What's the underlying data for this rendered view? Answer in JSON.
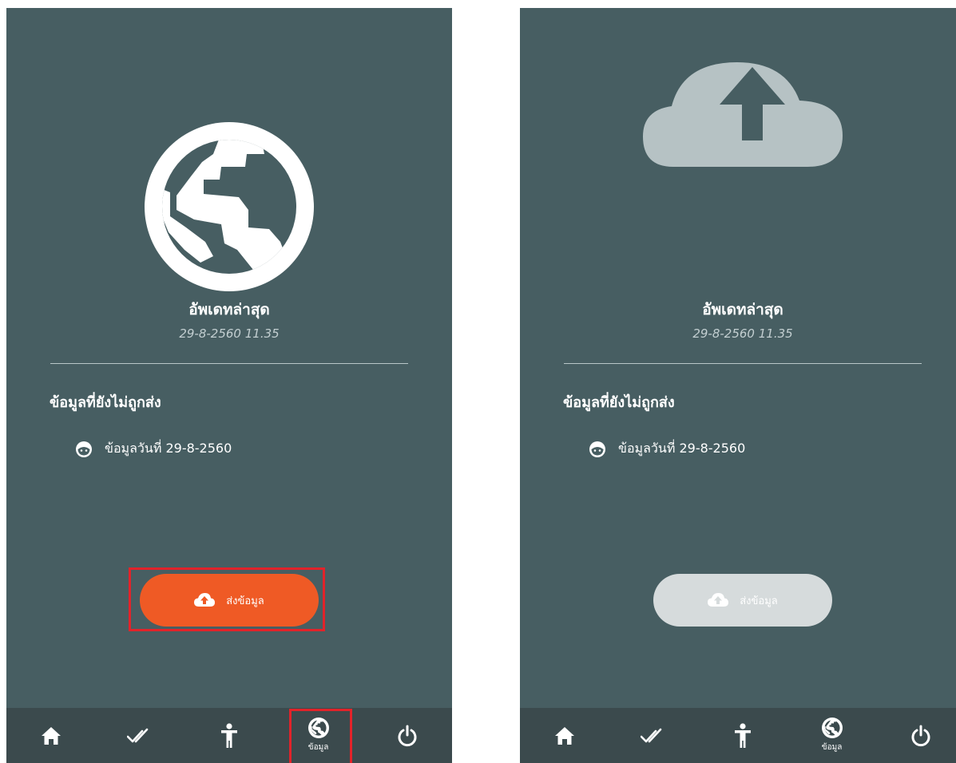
{
  "screens": [
    {
      "update_title": "อัพเดทล่าสุด",
      "update_time": "29-8-2560  11.35",
      "section_title": "ข้อมูลที่ยังไม่ถูกส่ง",
      "data_item": "ข้อมูลวันที่ 29-8-2560",
      "send_button_label": "ส่งข้อมูล",
      "nav_active_label": "ข้อมูล"
    },
    {
      "update_title": "อัพเดทล่าสุด",
      "update_time": "29-8-2560  11.35",
      "section_title": "ข้อมูลที่ยังไม่ถูกส่ง",
      "data_item": "ข้อมูลวันที่ 29-8-2560",
      "send_button_label": "ส่งข้อมูล",
      "nav_active_label": "ข้อมูล"
    }
  ],
  "colors": {
    "screen_bg": "#475e62",
    "nav_bg": "#3b4a4d",
    "accent_orange": "#ef5a25",
    "disabled_button": "#d6dbdc",
    "highlight_red": "#e2232a"
  },
  "icons": {
    "hero_left": "globe-icon",
    "hero_right": "cloud-upload-icon",
    "data_item": "face-icon",
    "nav": [
      "home-icon",
      "double-check-icon",
      "person-icon",
      "globe-icon",
      "power-icon"
    ]
  }
}
